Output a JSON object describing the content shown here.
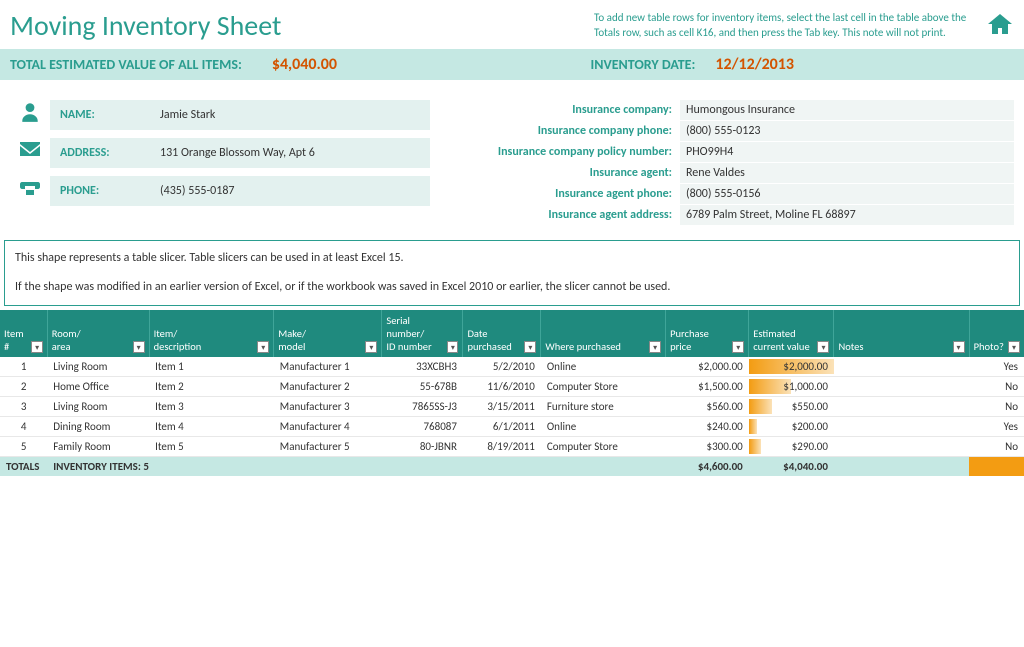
{
  "title": "Moving Inventory Sheet",
  "note": "To add new table rows for inventory items, select the last cell in the table above the Totals row, such as cell K16, and then press the Tab key. This note will not print.",
  "totals_bar": {
    "label1": "TOTAL ESTIMATED VALUE OF ALL ITEMS:",
    "value1": "$4,040.00",
    "label2": "INVENTORY DATE:",
    "value2": "12/12/2013"
  },
  "personal": {
    "name_label": "NAME:",
    "name": "Jamie Stark",
    "address_label": "ADDRESS:",
    "address": "131 Orange Blossom Way, Apt 6",
    "phone_label": "PHONE:",
    "phone": "(435) 555-0187"
  },
  "insurance": {
    "company_label": "Insurance company:",
    "company": "Humongous Insurance",
    "company_phone_label": "Insurance company phone:",
    "company_phone": "(800) 555-0123",
    "policy_label": "Insurance company policy number:",
    "policy": "PHO99H4",
    "agent_label": "Insurance agent:",
    "agent": "Rene Valdes",
    "agent_phone_label": "Insurance agent phone:",
    "agent_phone": "(800) 555-0156",
    "agent_address_label": "Insurance agent address:",
    "agent_address": "6789 Palm Street, Moline FL 68897"
  },
  "slicer": {
    "line1": "This shape represents a table slicer. Table slicers can be used in at least Excel 15.",
    "line2": "If the shape was modified in an earlier version of Excel, or if the workbook was saved in Excel 2010 or earlier, the slicer cannot be used."
  },
  "columns": {
    "item": "Item #",
    "room": "Room/\narea",
    "desc": "Item/\ndescription",
    "make": "Make/\nmodel",
    "serial": "Serial number/\nID number",
    "date": "Date\npurchased",
    "where": "Where purchased",
    "price": "Purchase\nprice",
    "estval": "Estimated\ncurrent value",
    "notes": "Notes",
    "photo": "Photo?"
  },
  "rows": [
    {
      "n": "1",
      "room": "Living Room",
      "desc": "Item 1",
      "make": "Manufacturer 1",
      "serial": "33XCBH3",
      "date": "5/2/2010",
      "where": "Online",
      "price": "$2,000.00",
      "est": "$2,000.00",
      "bar": 100,
      "notes": "",
      "photo": "Yes"
    },
    {
      "n": "2",
      "room": "Home Office",
      "desc": "Item 2",
      "make": "Manufacturer 2",
      "serial": "55-678B",
      "date": "11/6/2010",
      "where": "Computer Store",
      "price": "$1,500.00",
      "est": "$1,000.00",
      "bar": 50,
      "notes": "",
      "photo": "No"
    },
    {
      "n": "3",
      "room": "Living Room",
      "desc": "Item 3",
      "make": "Manufacturer 3",
      "serial": "7865SS-J3",
      "date": "3/15/2011",
      "where": "Furniture store",
      "price": "$560.00",
      "est": "$550.00",
      "bar": 27,
      "notes": "",
      "photo": "No"
    },
    {
      "n": "4",
      "room": "Dining Room",
      "desc": "Item 4",
      "make": "Manufacturer 4",
      "serial": "768087",
      "date": "6/1/2011",
      "where": "Online",
      "price": "$240.00",
      "est": "$200.00",
      "bar": 10,
      "notes": "",
      "photo": "Yes"
    },
    {
      "n": "5",
      "room": "Family Room",
      "desc": "Item 5",
      "make": "Manufacturer 5",
      "serial": "80-JBNR",
      "date": "8/19/2011",
      "where": "Computer Store",
      "price": "$300.00",
      "est": "$290.00",
      "bar": 14,
      "notes": "",
      "photo": "No"
    }
  ],
  "totals_row": {
    "label": "TOTALS",
    "items": "INVENTORY ITEMS: 5",
    "price": "$4,600.00",
    "est": "$4,040.00"
  }
}
